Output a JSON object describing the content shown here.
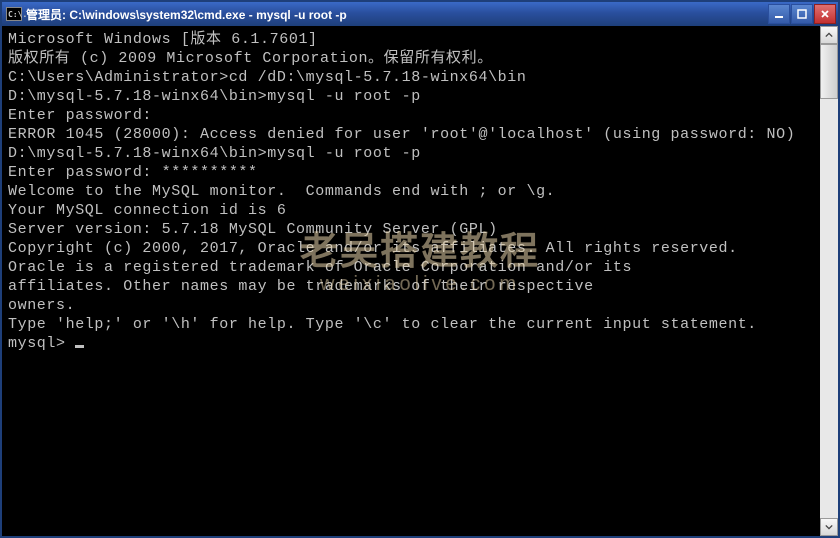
{
  "titlebar": {
    "icon_text": "C:\\.",
    "title": "管理员: C:\\windows\\system32\\cmd.exe - mysql  -u root -p"
  },
  "terminal": {
    "lines": [
      "Microsoft Windows [版本 6.1.7601]",
      "版权所有 (c) 2009 Microsoft Corporation。保留所有权利。",
      "",
      "C:\\Users\\Administrator>cd /dD:\\mysql-5.7.18-winx64\\bin",
      "",
      "D:\\mysql-5.7.18-winx64\\bin>mysql -u root -p",
      "Enter password:",
      "ERROR 1045 (28000): Access denied for user 'root'@'localhost' (using password: NO)",
      "",
      "D:\\mysql-5.7.18-winx64\\bin>mysql -u root -p",
      "Enter password: **********",
      "Welcome to the MySQL monitor.  Commands end with ; or \\g.",
      "Your MySQL connection id is 6",
      "Server version: 5.7.18 MySQL Community Server (GPL)",
      "",
      "Copyright (c) 2000, 2017, Oracle and/or its affiliates. All rights reserved.",
      "",
      "Oracle is a registered trademark of Oracle Corporation and/or its",
      "affiliates. Other names may be trademarks of their respective",
      "owners.",
      "",
      "Type 'help;' or '\\h' for help. Type '\\c' to clear the current input statement.",
      "",
      "mysql> "
    ]
  },
  "watermark": {
    "main": "老吴搭建教程",
    "sub": "weixiaolive.com"
  }
}
